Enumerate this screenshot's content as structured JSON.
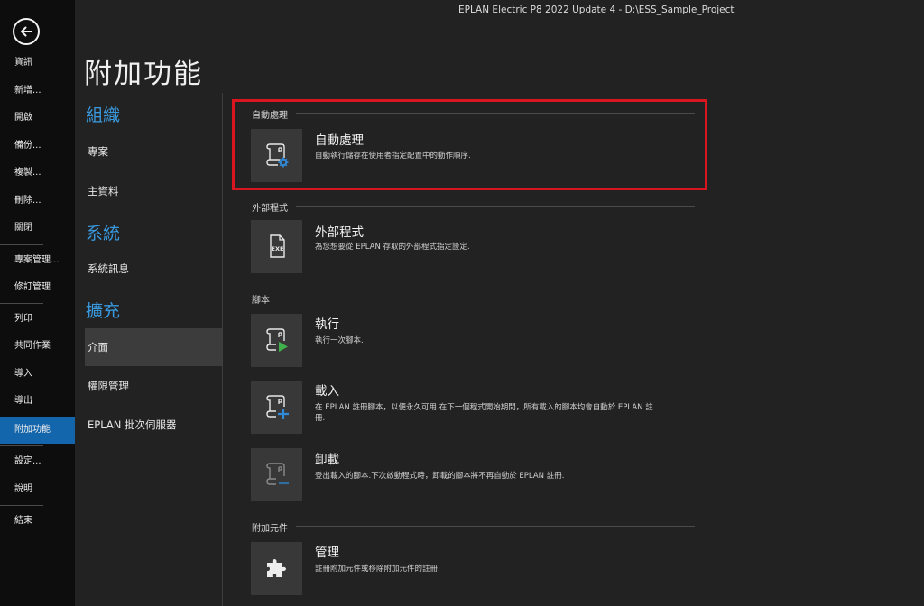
{
  "window": {
    "title": "EPLAN Electric P8 2022 Update 4 - D:\\ESS_Sample_Project"
  },
  "sidebar": {
    "back_icon": "back-arrow-icon",
    "items": [
      {
        "label": "資訊"
      },
      {
        "label": "新增..."
      },
      {
        "label": "開啟"
      },
      {
        "label": "備份..."
      },
      {
        "label": "複製..."
      },
      {
        "label": "刪除..."
      },
      {
        "label": "關閉"
      },
      {
        "label": "專案管理..."
      },
      {
        "label": "修訂管理"
      },
      {
        "label": "列印"
      },
      {
        "label": "共同作業"
      },
      {
        "label": "導入"
      },
      {
        "label": "導出"
      },
      {
        "label": "附加功能",
        "active": true
      },
      {
        "label": "設定..."
      },
      {
        "label": "說明"
      },
      {
        "label": "結束"
      }
    ],
    "active_color": "#1366ab"
  },
  "page": {
    "title": "附加功能"
  },
  "categories": {
    "groups": [
      {
        "heading": "組織",
        "items": [
          "專案",
          "主資料"
        ]
      },
      {
        "heading": "系統",
        "items": [
          "系統訊息"
        ]
      },
      {
        "heading": "擴充",
        "items": [
          "介面",
          "權限管理",
          "EPLAN 批次伺服器"
        ]
      }
    ],
    "selected": "介面",
    "heading_color": "#3a9ae0"
  },
  "sections": [
    {
      "title": "自動處理",
      "items": [
        {
          "icon": "automation-script-gear-icon",
          "title": "自動處理",
          "desc": "自動執行儲存在使用者指定配置中的動作順序."
        }
      ]
    },
    {
      "title": "外部程式",
      "items": [
        {
          "icon": "exe-file-icon",
          "title": "外部程式",
          "desc": "為您想要從 EPLAN 存取的外部程式指定設定."
        }
      ]
    },
    {
      "title": "腳本",
      "items": [
        {
          "icon": "script-run-icon",
          "title": "執行",
          "desc": "執行一次腳本."
        },
        {
          "icon": "script-load-icon",
          "title": "載入",
          "desc": "在 EPLAN 註冊腳本，以便永久可用.在下一個程式開始期間，所有載入的腳本均會自動於 EPLAN 註冊."
        },
        {
          "icon": "script-unload-icon",
          "title": "卸載",
          "desc": "登出載入的腳本.下次啟動程式時，卸載的腳本將不再自動於 EPLAN 註冊."
        }
      ]
    },
    {
      "title": "附加元件",
      "items": [
        {
          "icon": "puzzle-piece-icon",
          "title": "管理",
          "desc": "註冊附加元件或移除附加元件的註冊."
        }
      ]
    }
  ],
  "highlight_color": "#d9161f"
}
